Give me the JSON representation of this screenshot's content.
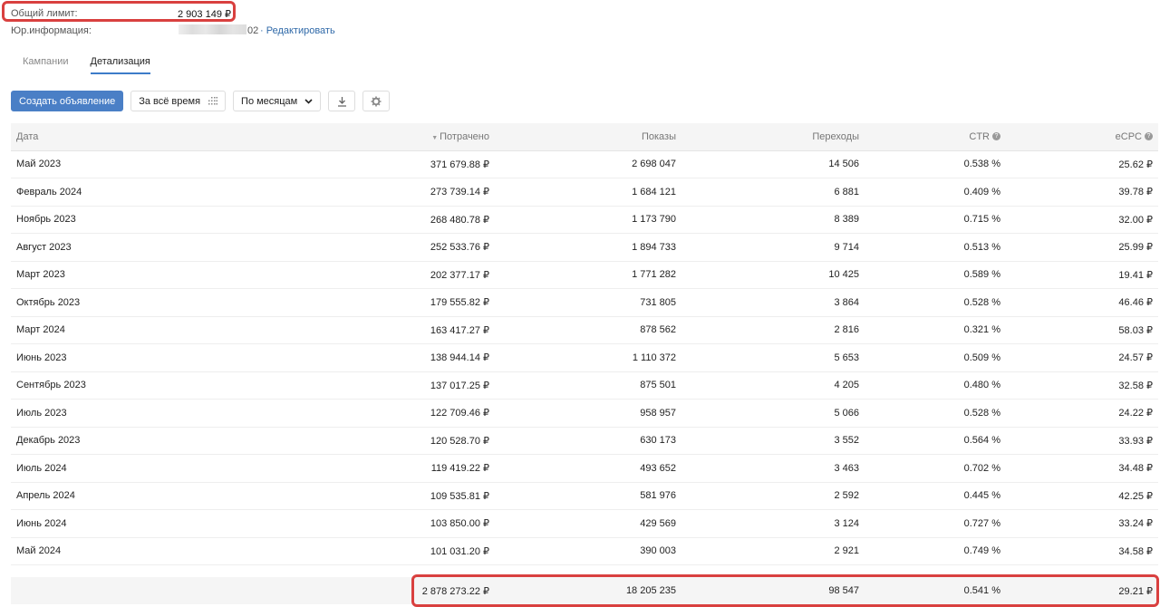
{
  "header": {
    "limit_label": "Общий лимит:",
    "limit_value": "2 903 149 ₽",
    "legal_label": "Юр.информация:",
    "legal_value_tail": "02",
    "edit_link": "· Редактировать"
  },
  "tabs": [
    {
      "label": "Кампании",
      "active": false
    },
    {
      "label": "Детализация",
      "active": true
    }
  ],
  "toolbar": {
    "create_label": "Создать объявление",
    "period_label": "За всё время",
    "group_label": "По месяцам",
    "download_icon": "download-icon",
    "settings_icon": "gear-icon"
  },
  "columns": [
    "Дата",
    "Потрачено",
    "Показы",
    "Переходы",
    "CTR",
    "eCPC"
  ],
  "sort": {
    "column": "Потрачено",
    "direction": "desc"
  },
  "rows": [
    [
      "Май 2023",
      "371 679.88 ₽",
      "2 698 047",
      "14 506",
      "0.538 %",
      "25.62 ₽"
    ],
    [
      "Февраль 2024",
      "273 739.14 ₽",
      "1 684 121",
      "6 881",
      "0.409 %",
      "39.78 ₽"
    ],
    [
      "Ноябрь 2023",
      "268 480.78 ₽",
      "1 173 790",
      "8 389",
      "0.715 %",
      "32.00 ₽"
    ],
    [
      "Август 2023",
      "252 533.76 ₽",
      "1 894 733",
      "9 714",
      "0.513 %",
      "25.99 ₽"
    ],
    [
      "Март 2023",
      "202 377.17 ₽",
      "1 771 282",
      "10 425",
      "0.589 %",
      "19.41 ₽"
    ],
    [
      "Октябрь 2023",
      "179 555.82 ₽",
      "731 805",
      "3 864",
      "0.528 %",
      "46.46 ₽"
    ],
    [
      "Март 2024",
      "163 417.27 ₽",
      "878 562",
      "2 816",
      "0.321 %",
      "58.03 ₽"
    ],
    [
      "Июнь 2023",
      "138 944.14 ₽",
      "1 110 372",
      "5 653",
      "0.509 %",
      "24.57 ₽"
    ],
    [
      "Сентябрь 2023",
      "137 017.25 ₽",
      "875 501",
      "4 205",
      "0.480 %",
      "32.58 ₽"
    ],
    [
      "Июль 2023",
      "122 709.46 ₽",
      "958 957",
      "5 066",
      "0.528 %",
      "24.22 ₽"
    ],
    [
      "Декабрь 2023",
      "120 528.70 ₽",
      "630 173",
      "3 552",
      "0.564 %",
      "33.93 ₽"
    ],
    [
      "Июль 2024",
      "119 419.22 ₽",
      "493 652",
      "3 463",
      "0.702 %",
      "34.48 ₽"
    ],
    [
      "Апрель 2024",
      "109 535.81 ₽",
      "581 976",
      "2 592",
      "0.445 %",
      "42.25 ₽"
    ],
    [
      "Июнь 2024",
      "103 850.00 ₽",
      "429 569",
      "3 124",
      "0.727 %",
      "33.24 ₽"
    ],
    [
      "Май 2024",
      "101 031.20 ₽",
      "390 003",
      "2 921",
      "0.749 %",
      "34.58 ₽"
    ]
  ],
  "totals": [
    "",
    "2 878 273.22 ₽",
    "18 205 235",
    "98 547",
    "0.541 %",
    "29.21 ₽"
  ],
  "colors": {
    "accent": "#4a7fc6",
    "highlight": "#d9403f"
  }
}
